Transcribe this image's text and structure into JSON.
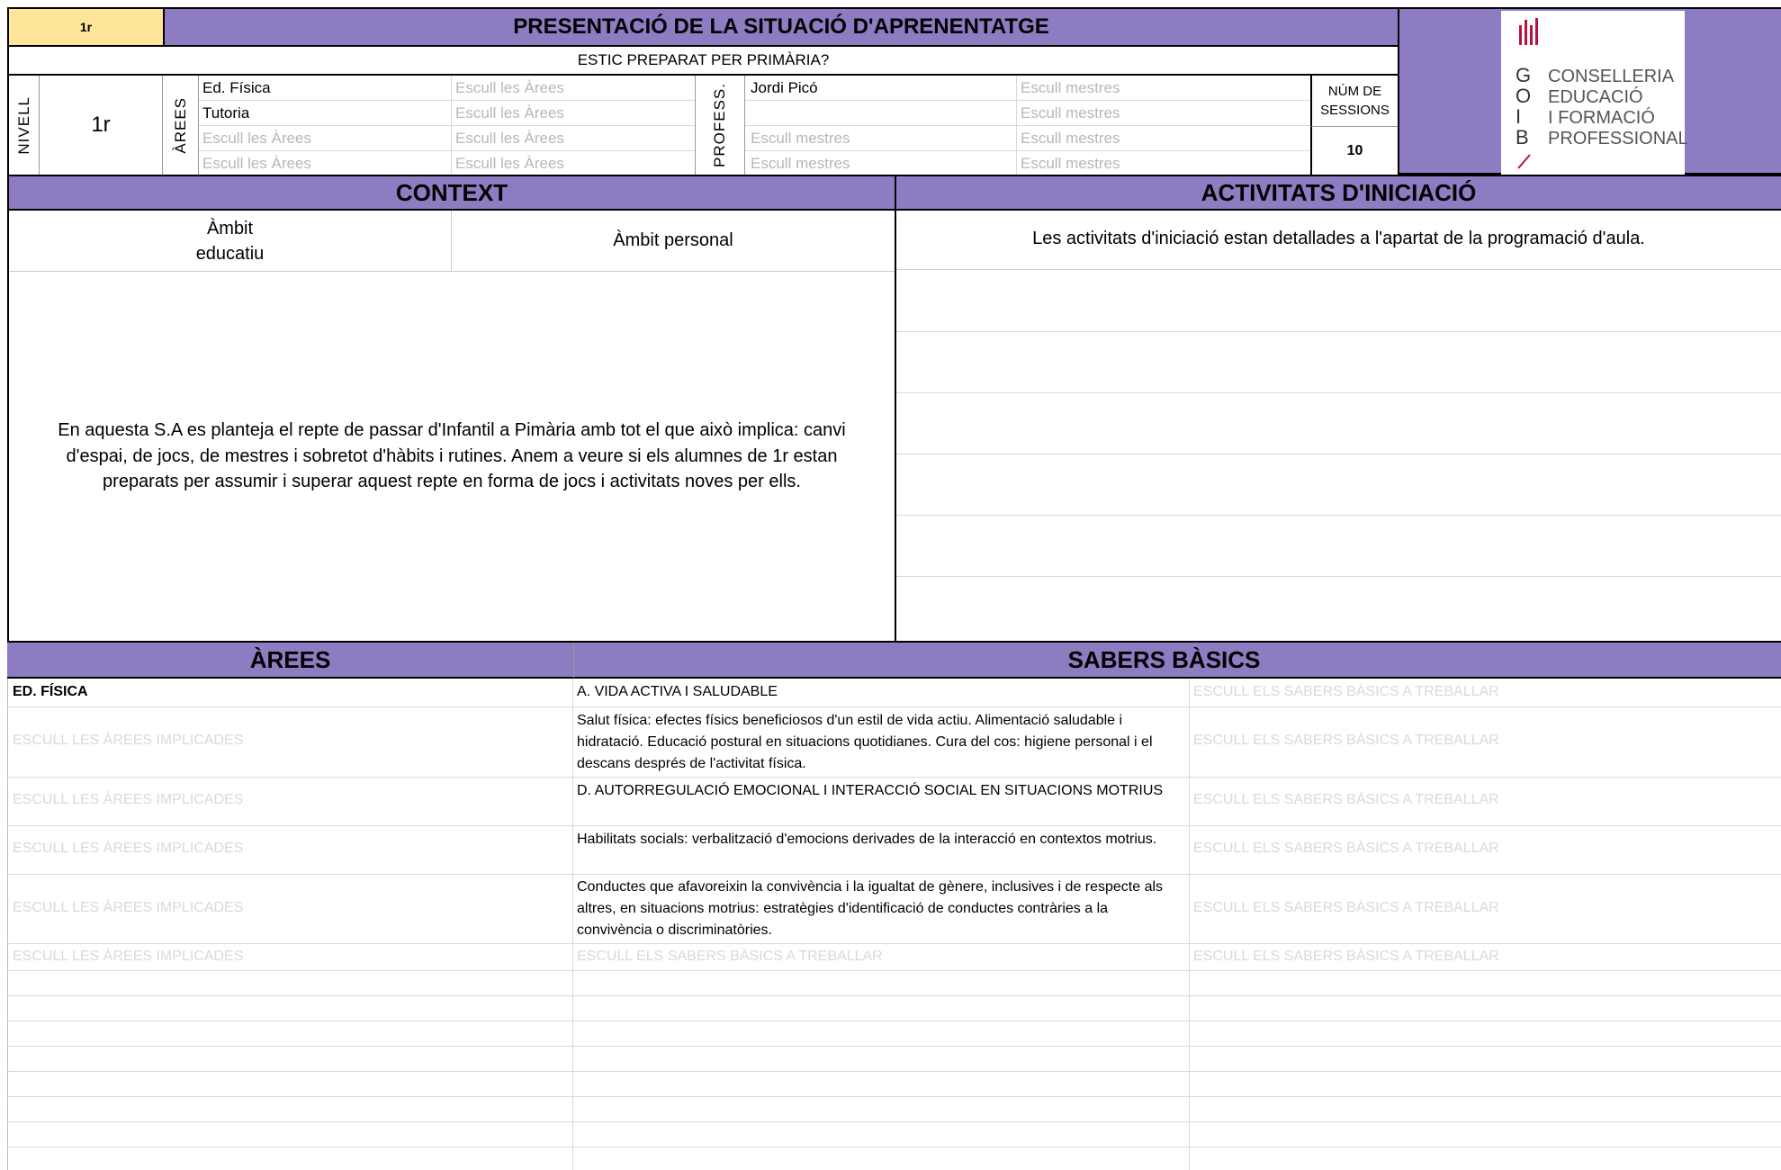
{
  "header": {
    "level_badge": "1r",
    "title": "PRESENTACIÓ DE LA SITUACIÓ D'APRENENTATGE",
    "subtitle": "ESTIC PREPARAT PER PRIMÀRIA?"
  },
  "info": {
    "nivell_label": "NIVELL",
    "nivell_value": "1r",
    "arees_label": "ÀREES",
    "arees": [
      [
        "Ed. Física",
        "Escull les Àrees"
      ],
      [
        "Tutoria",
        "Escull les Àrees"
      ],
      [
        "Escull les Àrees",
        "Escull les Àrees"
      ],
      [
        "Escull les Àrees",
        "Escull les Àrees"
      ]
    ],
    "profess_label": "PROFESS.",
    "mestres": [
      [
        "Jordi Picó",
        "Escull mestres"
      ],
      [
        "",
        "Escull mestres"
      ],
      [
        "Escull mestres",
        "Escull mestres"
      ],
      [
        "Escull mestres",
        "Escull mestres"
      ]
    ],
    "sessions_label": "NÚM DE SESSIONS",
    "sessions_value": "10"
  },
  "logo": {
    "letters": [
      "G",
      "O",
      "I",
      "B"
    ],
    "lines": [
      "CONSELLERIA",
      "EDUCACIÓ",
      "I FORMACIÓ",
      "PROFESSIONAL"
    ],
    "colors": {
      "mark": "#b5123f"
    }
  },
  "context": {
    "title": "CONTEXT",
    "ambit_educatiu": "Àmbit educatiu",
    "ambit_personal": "Àmbit personal",
    "text": "En aquesta S.A es planteja el repte de passar d'Infantil a Pimària amb tot el que això implica: canvi d'espai, de jocs, de mestres i sobretot d'hàbits i rutines. Anem a veure si els alumnes de 1r estan preparats per assumir i superar aquest repte en forma de jocs i activitats noves per ells."
  },
  "activitats": {
    "title": "ACTIVITATS D'INICIACIÓ",
    "text": "Les activitats d'iniciació estan detallades a l'apartat de la programació d'aula."
  },
  "sabers": {
    "arees_title": "ÀREES",
    "sabers_title": "SABERS BÀSICS",
    "rows": [
      {
        "area": "ED. FÍSICA",
        "saber1": "A. VIDA ACTIVA I SALUDABLE",
        "saber2": "ESCULL ELS SABERS BÀSICS A TREBALLAR"
      },
      {
        "area": "ESCULL LES ÀREES IMPLICADES",
        "saber1": "Salut física: efectes físics beneficiosos d'un estil de vida actiu. Alimentació saludable i hidratació. Educació postural en situacions quotidianes. Cura del cos: higiene personal i el descans després de l'activitat física.",
        "saber2": "ESCULL ELS SABERS BÀSICS A TREBALLAR"
      },
      {
        "area": "ESCULL LES ÀREES IMPLICADES",
        "saber1": "D. AUTORREGULACIÓ EMOCIONAL I INTERACCIÓ SOCIAL EN SITUACIONS MOTRIUS",
        "saber2": "ESCULL ELS SABERS BÀSICS A TREBALLAR"
      },
      {
        "area": "ESCULL LES ÀREES IMPLICADES",
        "saber1": "Habilitats socials: verbalització d'emocions derivades de la interacció en contextos motrius.",
        "saber2": "ESCULL ELS SABERS BÀSICS A TREBALLAR"
      },
      {
        "area": "ESCULL LES ÀREES IMPLICADES",
        "saber1": "Conductes que afavoreixin la convivència i la igualtat de gènere, inclusives i de respecte als altres, en situacions motrius: estratègies d'identificació de conductes contràries a la convivència o discriminatòries.",
        "saber2": "ESCULL ELS SABERS BÀSICS A TREBALLAR"
      },
      {
        "area": "ESCULL LES ÀREES IMPLICADES",
        "saber1": "ESCULL ELS SABERS BÀSICS A TREBALLAR",
        "saber2": "ESCULL ELS SABERS BÀSICS A TREBALLAR"
      }
    ]
  }
}
